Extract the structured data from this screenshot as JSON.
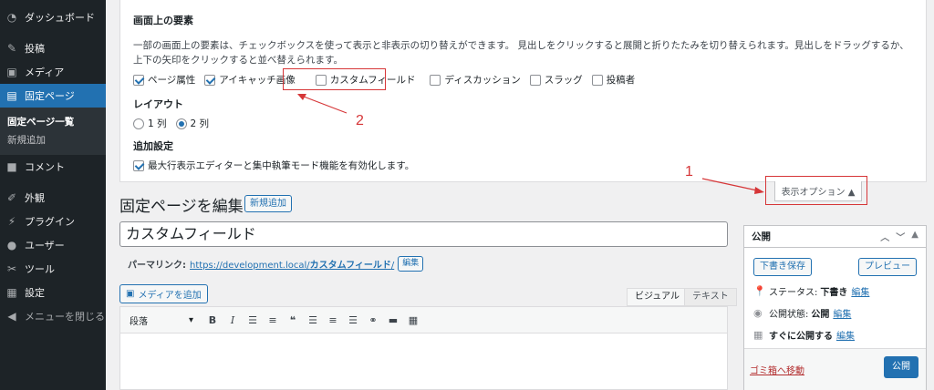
{
  "sidebar": {
    "items": [
      {
        "label": "ダッシュボード",
        "icon": "dashboard-icon"
      },
      {
        "label": "投稿",
        "icon": "pin-icon"
      },
      {
        "label": "メディア",
        "icon": "media-icon"
      },
      {
        "label": "固定ページ",
        "icon": "pages-icon"
      },
      {
        "label": "コメント",
        "icon": "comment-icon"
      },
      {
        "label": "外観",
        "icon": "brush-icon"
      },
      {
        "label": "プラグイン",
        "icon": "plugin-icon"
      },
      {
        "label": "ユーザー",
        "icon": "user-icon"
      },
      {
        "label": "ツール",
        "icon": "wrench-icon"
      },
      {
        "label": "設定",
        "icon": "settings-icon"
      },
      {
        "label": "メニューを閉じる",
        "icon": "collapse-icon"
      }
    ],
    "submenu": [
      "固定ページ一覧",
      "新規追加"
    ]
  },
  "screen_options": {
    "heading": "画面上の要素",
    "description": "一部の画面上の要素は、チェックボックスを使って表示と非表示の切り替えができます。 見出しをクリックすると展開と折りたたみを切り替えられます。見出しをドラッグするか、上下の矢印をクリックすると並べ替えられます。",
    "checkboxes": [
      {
        "label": "ページ属性",
        "checked": true
      },
      {
        "label": "アイキャッチ画像",
        "checked": true
      },
      {
        "label": "カスタムフィールド",
        "checked": false
      },
      {
        "label": "ディスカッション",
        "checked": false
      },
      {
        "label": "スラッグ",
        "checked": false
      },
      {
        "label": "投稿者",
        "checked": false
      }
    ],
    "layout_heading": "レイアウト",
    "layout_options": [
      {
        "label": "1 列",
        "selected": false
      },
      {
        "label": "2 列",
        "selected": true
      }
    ],
    "extra_heading": "追加設定",
    "extra_option": {
      "label": "最大行表示エディターと集中執筆モード機能を有効化します。",
      "checked": true
    },
    "tab_label": "表示オプション ▲"
  },
  "annotations": {
    "one": "1",
    "two": "2",
    "color": "#d63638"
  },
  "editor": {
    "page_title": "固定ページを編集",
    "add_new": "新規追加",
    "title_value": "カスタムフィールド",
    "permalink_label": "パーマリンク:",
    "permalink_base": "https://development.local/",
    "permalink_slug": "カスタムフィールド",
    "permalink_end": "/",
    "edit_label": "編集",
    "add_media": "メディアを追加",
    "tab_visual": "ビジュアル",
    "tab_text": "テキスト",
    "format_select": "段落"
  },
  "publish": {
    "heading": "公開",
    "save_draft": "下書き保存",
    "preview": "プレビュー",
    "status_label": "ステータス:",
    "status_value": "下書き",
    "visibility_label": "公開状態:",
    "visibility_value": "公開",
    "schedule_label": "すぐに公開する",
    "edit": "編集",
    "trash": "ゴミ箱へ移動",
    "publish_btn": "公開"
  },
  "colors": {
    "accent": "#2271b1",
    "sidebar_bg": "#1d2327"
  }
}
